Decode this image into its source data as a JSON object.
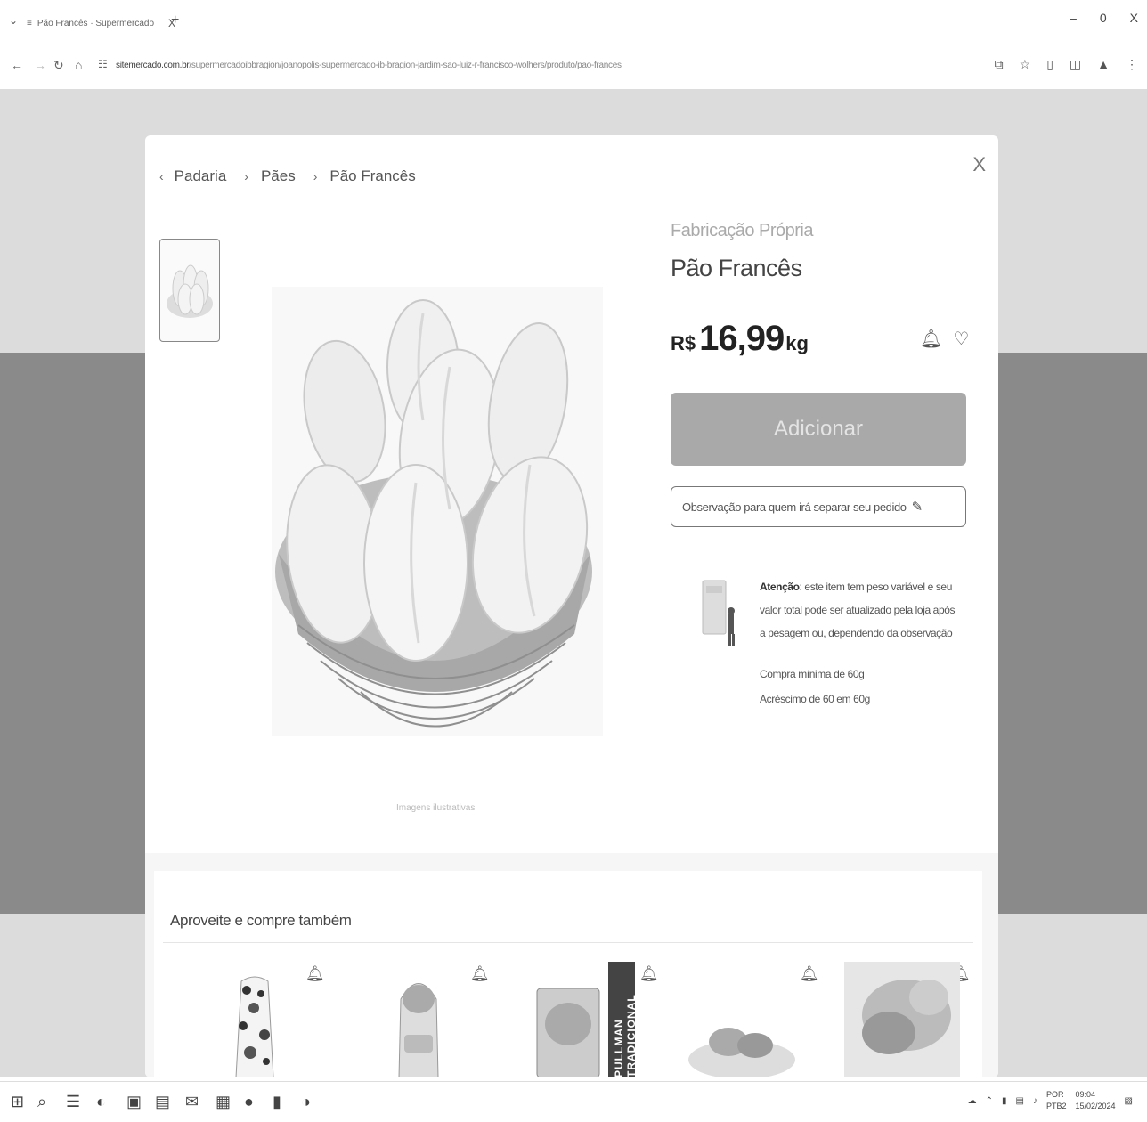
{
  "browser": {
    "tab_menu_icon": "chevron-down",
    "tab_title": "Pão Francês · Supermercado",
    "tab_close": "X",
    "new_tab": "+",
    "window_controls": [
      "–",
      "0",
      "X"
    ],
    "url_host": "sitemercado.com.br",
    "url_path": "/supermercadoibbragion/joanopolis-supermercado-ib-bragion-jardim-sao-luiz-r-francisco-wolhers/produto/pao-frances"
  },
  "modal": {
    "close_label": "X",
    "breadcrumb": [
      "Padaria",
      "Pães",
      "Pão Francês"
    ],
    "brand": "Fabricação Própria",
    "title": "Pão Francês",
    "price": {
      "currency": "R$",
      "value": "16,99",
      "unit": "kg"
    },
    "add_button": "Adicionar",
    "note_button": "Observação para quem irá separar seu pedido",
    "attention_label": "Atenção",
    "attention_text": ": este item tem peso variável e seu valor total pode ser atualizado pela loja após a pesagem ou, dependendo da observação",
    "min_buy": "Compra mínima de 60g",
    "increment": "Acréscimo de 60 em 60g",
    "image_caption": "Imagens ilustrativas"
  },
  "related": {
    "title": "Aproveite e compre também",
    "pullman_label": "PULLMAN TRADICIONAL"
  },
  "taskbar": {
    "lang_top": "POR",
    "lang_bottom": "PTB2",
    "time": "09:04",
    "date": "15/02/2024"
  },
  "colors": {
    "add_button_bg": "#a9a9a9",
    "backdrop": "#dcdcdc",
    "band": "#8a8a8a"
  }
}
